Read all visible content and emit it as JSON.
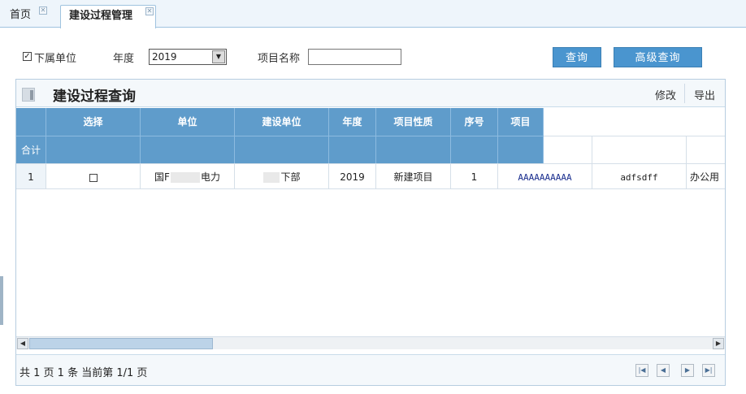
{
  "tabs": [
    {
      "label": "首页",
      "active": false
    },
    {
      "label": "建设过程管理",
      "active": true
    }
  ],
  "filter": {
    "subunit_checked": true,
    "subunit_label": "下属单位",
    "year_label": "年度",
    "year_value": "2019",
    "project_name_label": "项目名称",
    "project_name_value": "",
    "query_button": "查询",
    "advanced_query_button": "高级查询"
  },
  "panel": {
    "title": "建设过程查询",
    "edit_button": "修改",
    "export_button": "导出"
  },
  "table": {
    "columns": [
      "选择",
      "单位",
      "建设单位",
      "年度",
      "项目性质",
      "序号",
      "项目"
    ],
    "summary_label": "合计",
    "rows": [
      {
        "index": "1",
        "selected": false,
        "unit_prefix": "国F",
        "unit_suffix": "电力",
        "build_unit_suffix": "下部",
        "year": "2019",
        "nature": "新建项目",
        "seq": "1",
        "project": "AAAAAAAAAA",
        "col8": "adfsdff",
        "col9": "办公用"
      }
    ]
  },
  "pager": {
    "summary": "共 1 页 1 条 当前第 1/1 页"
  },
  "colors": {
    "header_bg": "#5f9ccb",
    "button_bg": "#4a95cf",
    "link_text": "#1b2f8f"
  }
}
